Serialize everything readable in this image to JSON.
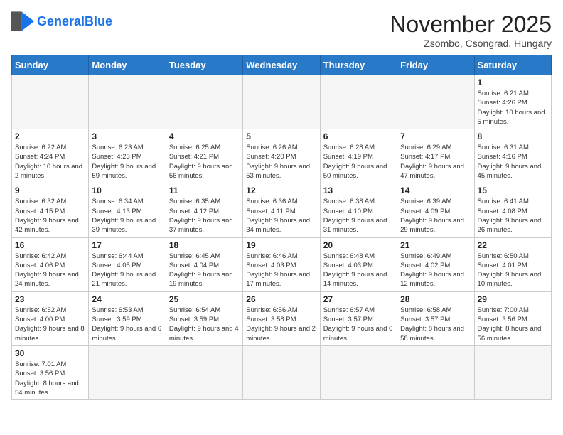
{
  "logo": {
    "text_general": "General",
    "text_blue": "Blue"
  },
  "header": {
    "month_title": "November 2025",
    "location": "Zsombo, Csongrad, Hungary"
  },
  "weekdays": [
    "Sunday",
    "Monday",
    "Tuesday",
    "Wednesday",
    "Thursday",
    "Friday",
    "Saturday"
  ],
  "weeks": [
    [
      {
        "day": "",
        "info": ""
      },
      {
        "day": "",
        "info": ""
      },
      {
        "day": "",
        "info": ""
      },
      {
        "day": "",
        "info": ""
      },
      {
        "day": "",
        "info": ""
      },
      {
        "day": "",
        "info": ""
      },
      {
        "day": "1",
        "info": "Sunrise: 6:21 AM\nSunset: 4:26 PM\nDaylight: 10 hours and 5 minutes."
      }
    ],
    [
      {
        "day": "2",
        "info": "Sunrise: 6:22 AM\nSunset: 4:24 PM\nDaylight: 10 hours and 2 minutes."
      },
      {
        "day": "3",
        "info": "Sunrise: 6:23 AM\nSunset: 4:23 PM\nDaylight: 9 hours and 59 minutes."
      },
      {
        "day": "4",
        "info": "Sunrise: 6:25 AM\nSunset: 4:21 PM\nDaylight: 9 hours and 56 minutes."
      },
      {
        "day": "5",
        "info": "Sunrise: 6:26 AM\nSunset: 4:20 PM\nDaylight: 9 hours and 53 minutes."
      },
      {
        "day": "6",
        "info": "Sunrise: 6:28 AM\nSunset: 4:19 PM\nDaylight: 9 hours and 50 minutes."
      },
      {
        "day": "7",
        "info": "Sunrise: 6:29 AM\nSunset: 4:17 PM\nDaylight: 9 hours and 47 minutes."
      },
      {
        "day": "8",
        "info": "Sunrise: 6:31 AM\nSunset: 4:16 PM\nDaylight: 9 hours and 45 minutes."
      }
    ],
    [
      {
        "day": "9",
        "info": "Sunrise: 6:32 AM\nSunset: 4:15 PM\nDaylight: 9 hours and 42 minutes."
      },
      {
        "day": "10",
        "info": "Sunrise: 6:34 AM\nSunset: 4:13 PM\nDaylight: 9 hours and 39 minutes."
      },
      {
        "day": "11",
        "info": "Sunrise: 6:35 AM\nSunset: 4:12 PM\nDaylight: 9 hours and 37 minutes."
      },
      {
        "day": "12",
        "info": "Sunrise: 6:36 AM\nSunset: 4:11 PM\nDaylight: 9 hours and 34 minutes."
      },
      {
        "day": "13",
        "info": "Sunrise: 6:38 AM\nSunset: 4:10 PM\nDaylight: 9 hours and 31 minutes."
      },
      {
        "day": "14",
        "info": "Sunrise: 6:39 AM\nSunset: 4:09 PM\nDaylight: 9 hours and 29 minutes."
      },
      {
        "day": "15",
        "info": "Sunrise: 6:41 AM\nSunset: 4:08 PM\nDaylight: 9 hours and 26 minutes."
      }
    ],
    [
      {
        "day": "16",
        "info": "Sunrise: 6:42 AM\nSunset: 4:06 PM\nDaylight: 9 hours and 24 minutes."
      },
      {
        "day": "17",
        "info": "Sunrise: 6:44 AM\nSunset: 4:05 PM\nDaylight: 9 hours and 21 minutes."
      },
      {
        "day": "18",
        "info": "Sunrise: 6:45 AM\nSunset: 4:04 PM\nDaylight: 9 hours and 19 minutes."
      },
      {
        "day": "19",
        "info": "Sunrise: 6:46 AM\nSunset: 4:03 PM\nDaylight: 9 hours and 17 minutes."
      },
      {
        "day": "20",
        "info": "Sunrise: 6:48 AM\nSunset: 4:03 PM\nDaylight: 9 hours and 14 minutes."
      },
      {
        "day": "21",
        "info": "Sunrise: 6:49 AM\nSunset: 4:02 PM\nDaylight: 9 hours and 12 minutes."
      },
      {
        "day": "22",
        "info": "Sunrise: 6:50 AM\nSunset: 4:01 PM\nDaylight: 9 hours and 10 minutes."
      }
    ],
    [
      {
        "day": "23",
        "info": "Sunrise: 6:52 AM\nSunset: 4:00 PM\nDaylight: 9 hours and 8 minutes."
      },
      {
        "day": "24",
        "info": "Sunrise: 6:53 AM\nSunset: 3:59 PM\nDaylight: 9 hours and 6 minutes."
      },
      {
        "day": "25",
        "info": "Sunrise: 6:54 AM\nSunset: 3:59 PM\nDaylight: 9 hours and 4 minutes."
      },
      {
        "day": "26",
        "info": "Sunrise: 6:56 AM\nSunset: 3:58 PM\nDaylight: 9 hours and 2 minutes."
      },
      {
        "day": "27",
        "info": "Sunrise: 6:57 AM\nSunset: 3:57 PM\nDaylight: 9 hours and 0 minutes."
      },
      {
        "day": "28",
        "info": "Sunrise: 6:58 AM\nSunset: 3:57 PM\nDaylight: 8 hours and 58 minutes."
      },
      {
        "day": "29",
        "info": "Sunrise: 7:00 AM\nSunset: 3:56 PM\nDaylight: 8 hours and 56 minutes."
      }
    ],
    [
      {
        "day": "30",
        "info": "Sunrise: 7:01 AM\nSunset: 3:56 PM\nDaylight: 8 hours and 54 minutes."
      },
      {
        "day": "",
        "info": ""
      },
      {
        "day": "",
        "info": ""
      },
      {
        "day": "",
        "info": ""
      },
      {
        "day": "",
        "info": ""
      },
      {
        "day": "",
        "info": ""
      },
      {
        "day": "",
        "info": ""
      }
    ]
  ]
}
